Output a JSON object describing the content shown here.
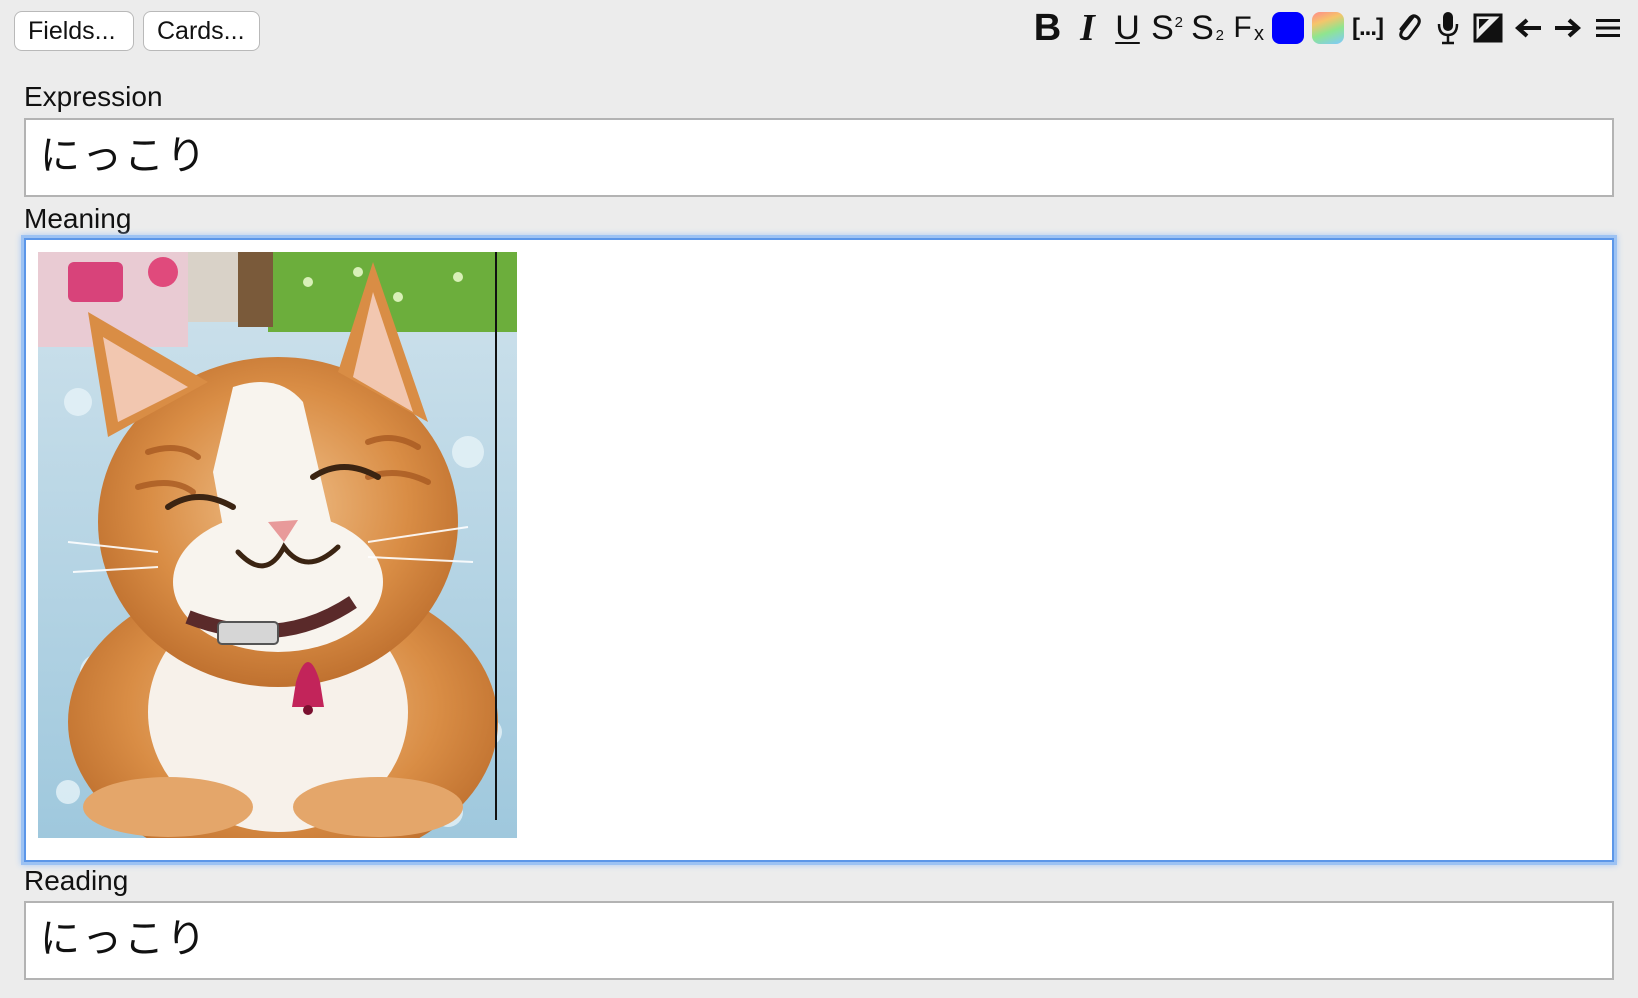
{
  "topbar": {
    "fields_button": "Fields...",
    "cards_button": "Cards..."
  },
  "toolbar": {
    "bold": "B",
    "italic": "I",
    "underline": "U",
    "superscript": "S",
    "superscript_mark": "2",
    "subscript": "S",
    "subscript_mark": "2",
    "clear_format": "F",
    "clear_format_mark": "x",
    "text_color": "#0000ff",
    "cloze": "[...]",
    "icons": [
      "bold-icon",
      "italic-icon",
      "underline-icon",
      "superscript-icon",
      "subscript-icon",
      "clear-format-icon",
      "text-color-icon",
      "highlight-color-icon",
      "cloze-icon",
      "attach-icon",
      "record-audio-icon",
      "image-occlusion-icon",
      "previous-icon",
      "next-icon",
      "menu-icon"
    ]
  },
  "fields": {
    "expression": {
      "label": "Expression",
      "value": "にっこり"
    },
    "meaning": {
      "label": "Meaning",
      "image_description_icon": "smiling-cat-image"
    },
    "reading": {
      "label": "Reading",
      "value": "にっこり"
    }
  },
  "colors": {
    "background": "#ececec",
    "focus_border": "#5b96e8",
    "text_color_swatch": "#0000ff"
  }
}
